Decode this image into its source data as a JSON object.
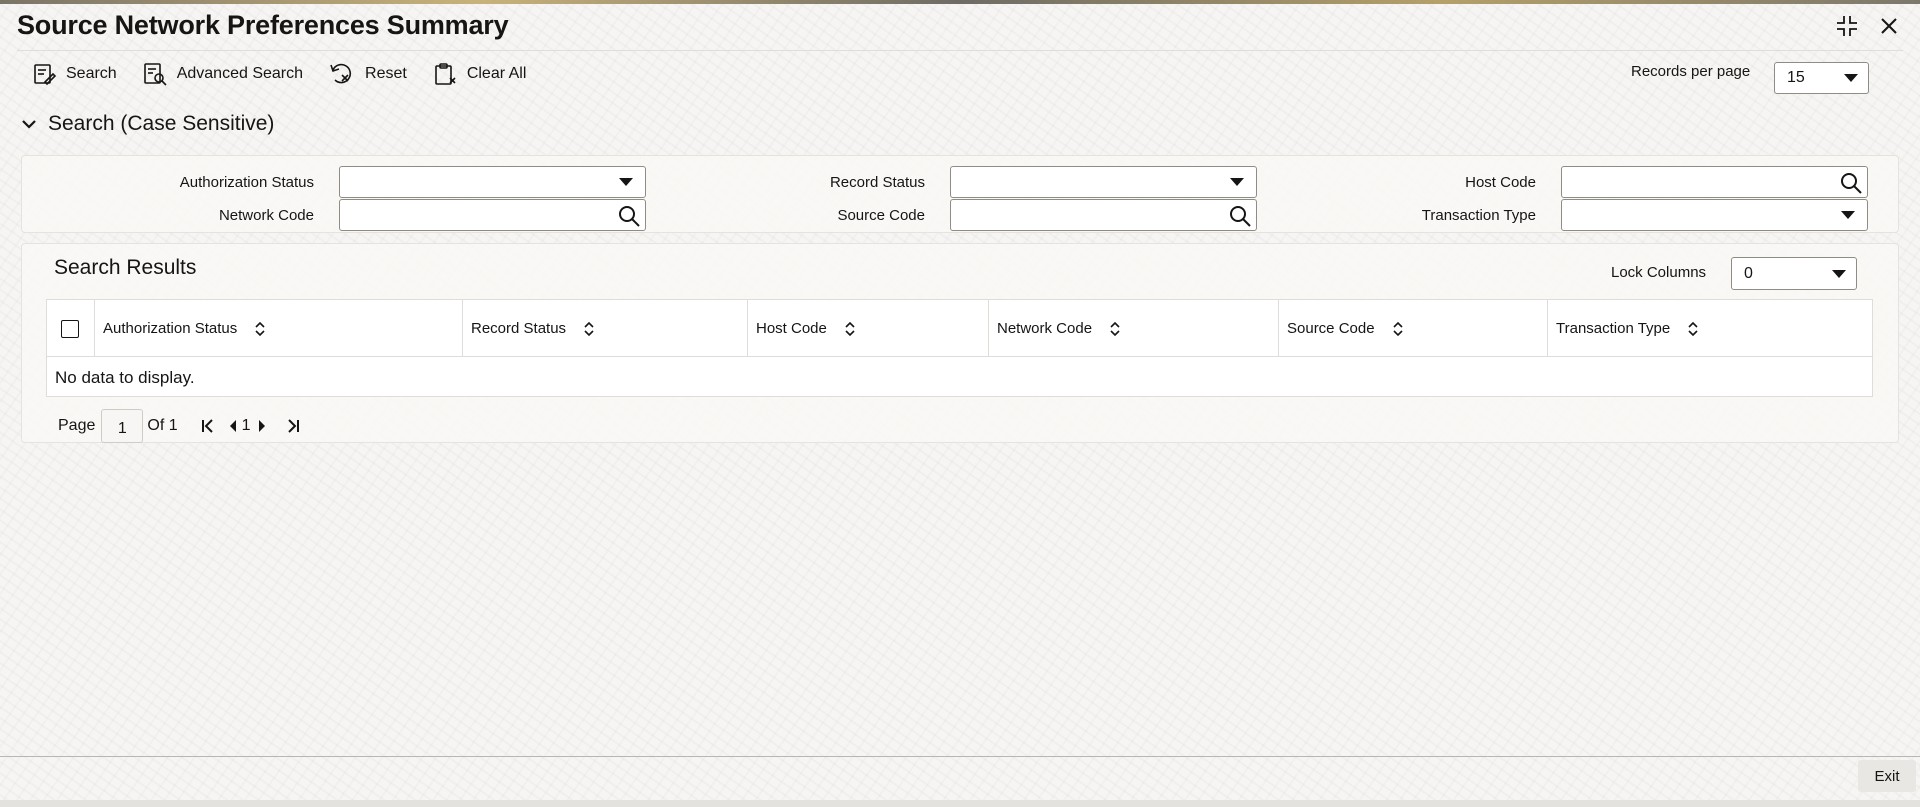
{
  "window": {
    "title": "Source Network Preferences Summary",
    "controls": [
      "maximize-icon",
      "close-icon"
    ]
  },
  "toolbar": {
    "search_label": "Search",
    "advanced_search_label": "Advanced Search",
    "reset_label": "Reset",
    "clear_all_label": "Clear All"
  },
  "records_per_page": {
    "label": "Records per page",
    "value": "15"
  },
  "criteria": {
    "section_title": "Search (Case Sensitive)",
    "authorization_status": {
      "label": "Authorization Status",
      "value": ""
    },
    "record_status": {
      "label": "Record Status",
      "value": ""
    },
    "host_code": {
      "label": "Host Code",
      "value": ""
    },
    "network_code": {
      "label": "Network Code",
      "value": ""
    },
    "source_code": {
      "label": "Source Code",
      "value": ""
    },
    "transaction_type": {
      "label": "Transaction Type",
      "value": ""
    }
  },
  "results": {
    "title": "Search Results",
    "lock_columns": {
      "label": "Lock Columns",
      "value": "0"
    },
    "columns": [
      "Authorization Status",
      "Record Status",
      "Host Code",
      "Network Code",
      "Source Code",
      "Transaction Type"
    ],
    "rows": [],
    "empty_message": "No data to display."
  },
  "pagination": {
    "page_label": "Page",
    "current_page": "1",
    "of_label": "Of 1",
    "page_number": "1"
  },
  "footer": {
    "exit_label": "Exit"
  }
}
